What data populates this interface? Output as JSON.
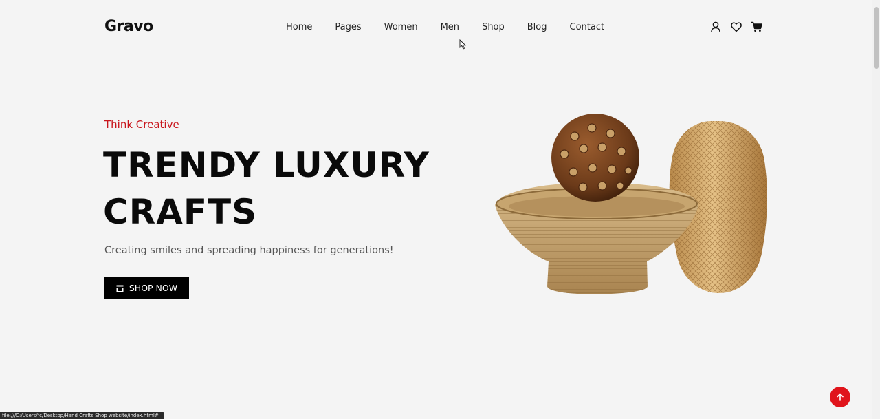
{
  "header": {
    "logo": "Gravo",
    "nav": [
      "Home",
      "Pages",
      "Women",
      "Men",
      "Shop",
      "Blog",
      "Contact"
    ],
    "icons": [
      "user-icon",
      "heart-icon",
      "cart-icon"
    ]
  },
  "hero": {
    "tagline": "Think Creative",
    "headline_line1": "TRENDY LUXURY",
    "headline_line2": "CRAFTS",
    "subtitle": "Creating smiles and spreading happiness for generations!",
    "cta_label": "SHOP NOW"
  },
  "status_bar": {
    "url": "file:///C:/Users/fc/Desktop/Hand Crafts Shop website/index.html#"
  },
  "colors": {
    "accent": "#c8161d",
    "background": "#f4f4f4",
    "button": "#000000",
    "back_to_top": "#e0141b"
  }
}
